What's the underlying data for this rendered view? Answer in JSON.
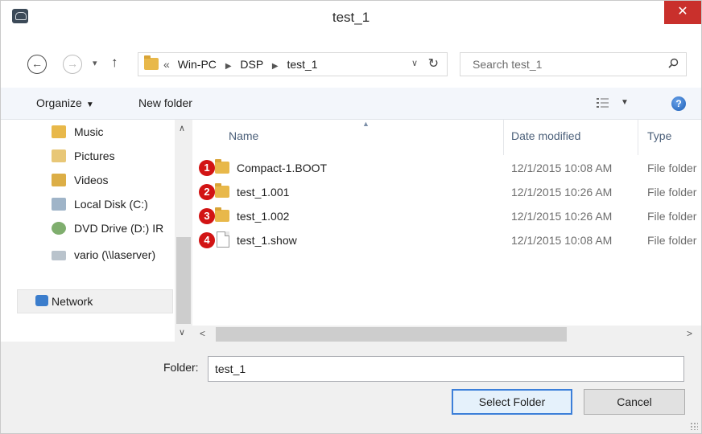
{
  "window": {
    "title": "test_1",
    "close_glyph": "✕"
  },
  "nav": {
    "back_glyph": "←",
    "forward_glyph": "→",
    "recent_glyph": "▾",
    "up_glyph": "↑",
    "breadcrumb": {
      "lead": "«",
      "items": [
        "Win-PC",
        "DSP",
        "test_1"
      ],
      "separator": "▶"
    },
    "address_dropdown_glyph": "∨",
    "refresh_glyph": "↻"
  },
  "search": {
    "placeholder": "Search test_1"
  },
  "toolbar": {
    "organize_label": "Organize",
    "organize_caret": "▼",
    "new_folder_label": "New folder",
    "view_caret": "▼",
    "help_glyph": "?"
  },
  "navpane": {
    "items": [
      {
        "label": "Music",
        "icon": "music-folder-icon"
      },
      {
        "label": "Pictures",
        "icon": "pictures-folder-icon"
      },
      {
        "label": "Videos",
        "icon": "videos-folder-icon"
      },
      {
        "label": "Local Disk (C:)",
        "icon": "local-disk-icon"
      },
      {
        "label": "DVD Drive (D:) IR",
        "icon": "dvd-drive-icon"
      },
      {
        "label": "vario (\\\\laserver)",
        "icon": "network-drive-icon"
      }
    ],
    "network_label": "Network",
    "scroll_up_glyph": "∧",
    "scroll_down_glyph": "∨"
  },
  "filelist": {
    "columns": {
      "name": "Name",
      "date_modified": "Date modified",
      "type": "Type"
    },
    "sort_glyph": "▲",
    "rows": [
      {
        "badge": "1",
        "name": "Compact-1.BOOT",
        "date": "12/1/2015 10:08 AM",
        "type": "File folder",
        "icon": "folder-icon"
      },
      {
        "badge": "2",
        "name": "test_1.001",
        "date": "12/1/2015 10:26 AM",
        "type": "File folder",
        "icon": "folder-icon"
      },
      {
        "badge": "3",
        "name": "test_1.002",
        "date": "12/1/2015 10:26 AM",
        "type": "File folder",
        "icon": "folder-icon"
      },
      {
        "badge": "4",
        "name": "test_1.show",
        "date": "12/1/2015 10:08 AM",
        "type": "File folder",
        "icon": "file-icon"
      }
    ],
    "scroll_left_glyph": "<",
    "scroll_right_glyph": ">"
  },
  "bottom": {
    "folder_label": "Folder:",
    "folder_value": "test_1",
    "select_button": "Select Folder",
    "cancel_button": "Cancel"
  },
  "colors": {
    "close_red": "#c9302c",
    "badge_red": "#d21414",
    "folder_yellow": "#e8b84a",
    "primary_border": "#3c7fd9"
  }
}
